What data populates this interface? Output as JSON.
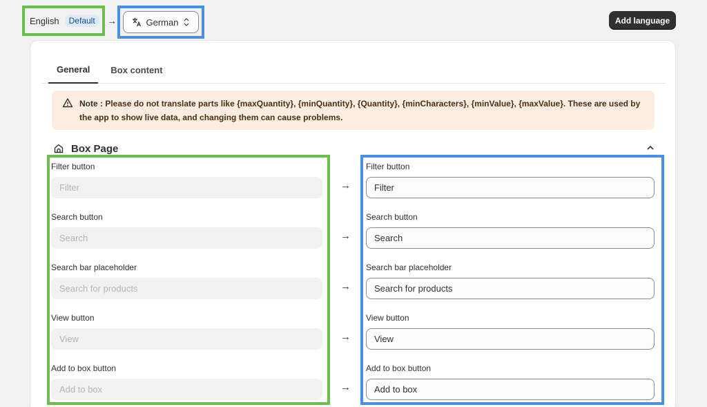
{
  "source_language": {
    "name": "English",
    "badge": "Default"
  },
  "arrow": "→",
  "target_language": {
    "name": "German"
  },
  "add_language_label": "Add language",
  "tabs": [
    {
      "label": "General",
      "active": true
    },
    {
      "label": "Box content",
      "active": false
    }
  ],
  "note": {
    "label": "Note",
    "text": " : Please do not translate parts like {maxQuantity}, {minQuantity}, {Quantity}, {minCharacters}, {minValue}, {maxValue}. These are used by the app to show live data, and changing them can cause problems."
  },
  "section": {
    "title": "Box Page"
  },
  "fields": [
    {
      "label": "Filter button",
      "source": "Filter",
      "target": "Filter"
    },
    {
      "label": "Search button",
      "source": "Search",
      "target": "Search"
    },
    {
      "label": "Search bar placeholder",
      "source": "Search for products",
      "target": "Search for products"
    },
    {
      "label": "View button",
      "source": "View",
      "target": "View"
    },
    {
      "label": "Add to box button",
      "source": "Add to box",
      "target": "Add to box"
    }
  ],
  "colors": {
    "source_highlight": "#6cbf4f",
    "target_highlight": "#4a90e2",
    "note_bg": "#fdece0",
    "primary_button": "#303030"
  },
  "icons": {
    "language_select": "translate-icon",
    "select_chevron": "chevron-up-down-icon",
    "note": "warning-triangle-icon",
    "section": "home-icon",
    "collapse": "chevron-up-icon"
  }
}
